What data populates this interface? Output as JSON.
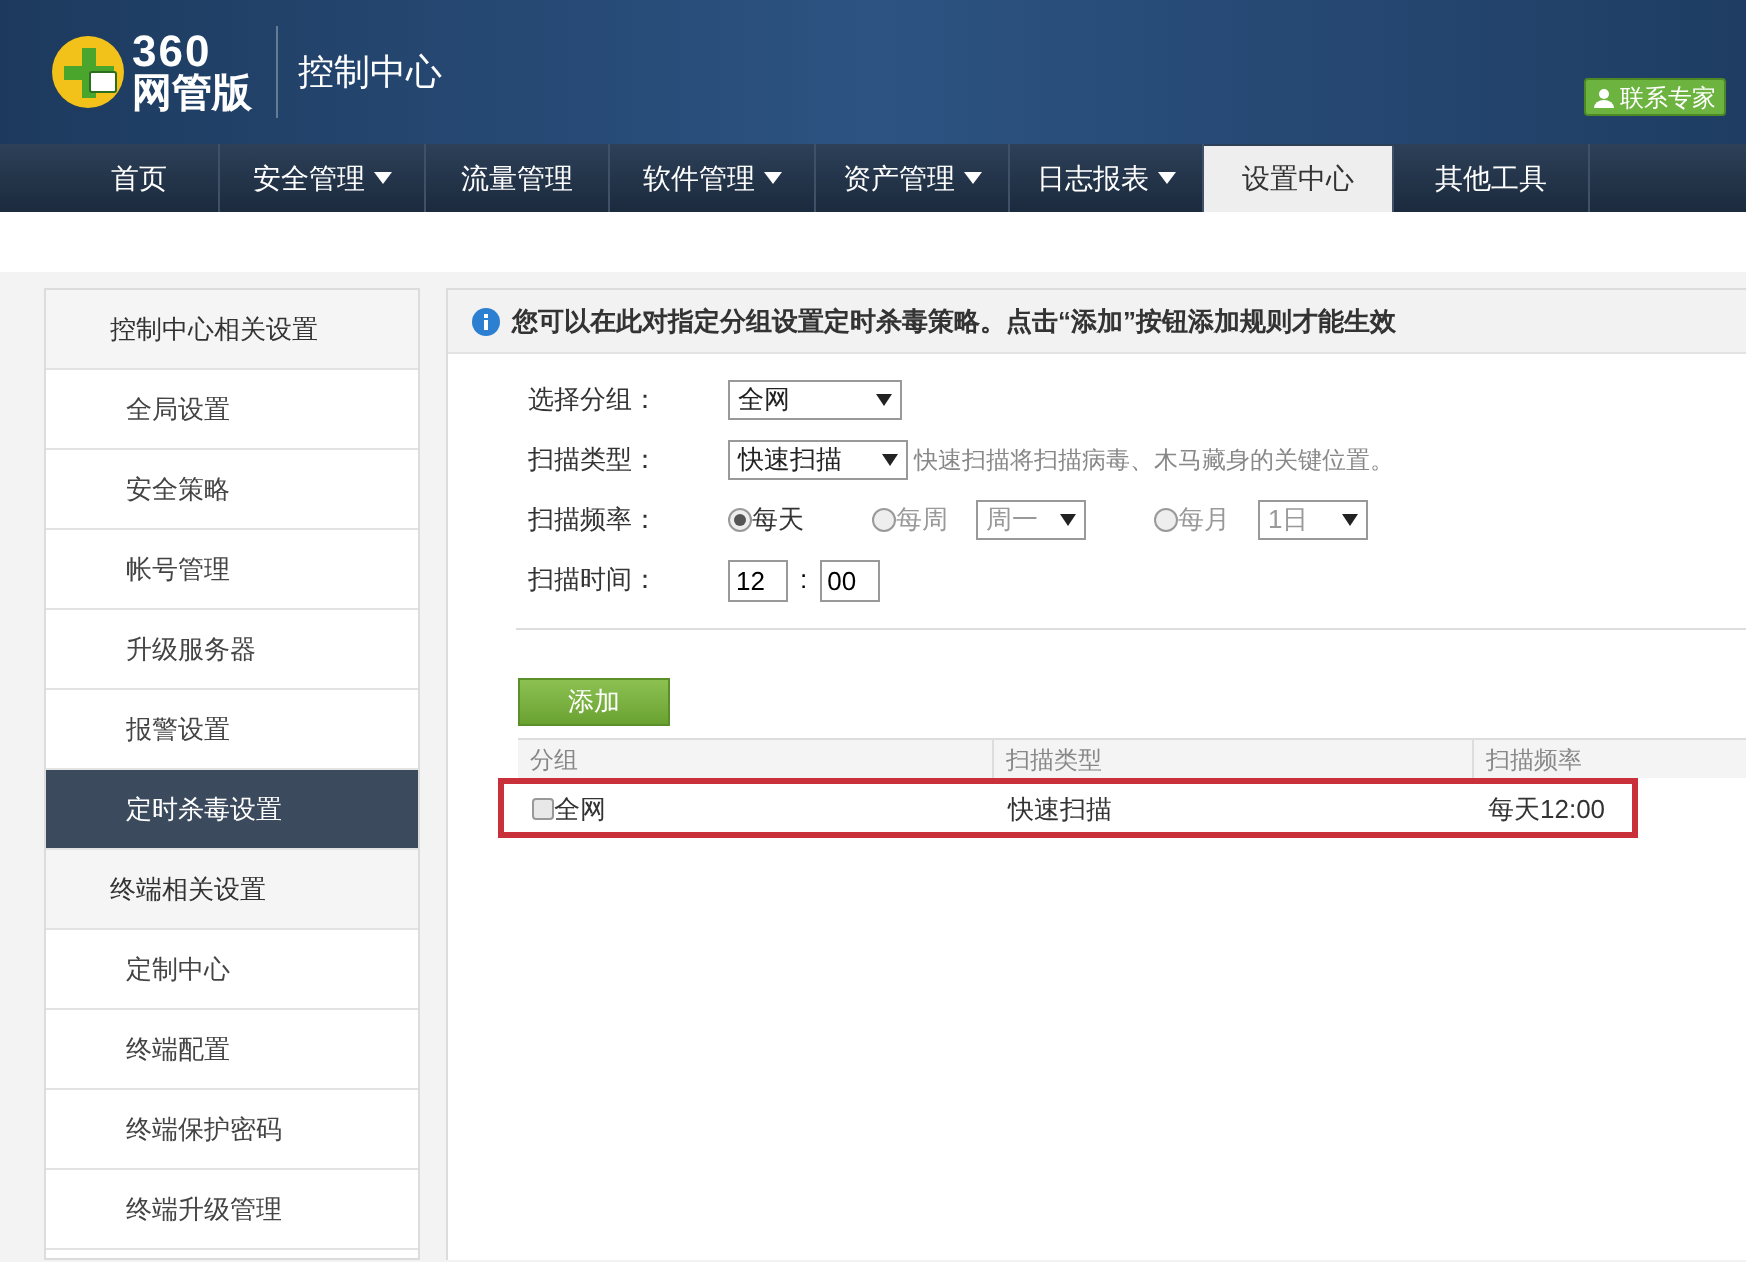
{
  "header": {
    "logo_number": "360",
    "logo_text": "网管版",
    "title": "控制中心",
    "contact_button": "联系专家"
  },
  "nav": [
    {
      "label": "首页",
      "dropdown": false,
      "selected": false
    },
    {
      "label": "安全管理",
      "dropdown": true,
      "selected": false
    },
    {
      "label": "流量管理",
      "dropdown": false,
      "selected": false
    },
    {
      "label": "软件管理",
      "dropdown": true,
      "selected": false
    },
    {
      "label": "资产管理",
      "dropdown": true,
      "selected": false
    },
    {
      "label": "日志报表",
      "dropdown": true,
      "selected": false
    },
    {
      "label": "设置中心",
      "dropdown": false,
      "selected": true
    },
    {
      "label": "其他工具",
      "dropdown": false,
      "selected": false
    }
  ],
  "sidebar": [
    {
      "kind": "section",
      "label": "控制中心相关设置"
    },
    {
      "kind": "item",
      "label": "全局设置",
      "selected": false
    },
    {
      "kind": "item",
      "label": "安全策略",
      "selected": false
    },
    {
      "kind": "item",
      "label": "帐号管理",
      "selected": false
    },
    {
      "kind": "item",
      "label": "升级服务器",
      "selected": false
    },
    {
      "kind": "item",
      "label": "报警设置",
      "selected": false
    },
    {
      "kind": "item",
      "label": "定时杀毒设置",
      "selected": true
    },
    {
      "kind": "section",
      "label": "终端相关设置"
    },
    {
      "kind": "item",
      "label": "定制中心",
      "selected": false
    },
    {
      "kind": "item",
      "label": "终端配置",
      "selected": false
    },
    {
      "kind": "item",
      "label": "终端保护密码",
      "selected": false
    },
    {
      "kind": "item",
      "label": "终端升级管理",
      "selected": false
    }
  ],
  "info": "您可以在此对指定分组设置定时杀毒策略。点击“添加”按钮添加规则才能生效",
  "form": {
    "group_label": "选择分组：",
    "group_value": "全网",
    "type_label": "扫描类型：",
    "type_value": "快速扫描",
    "type_hint": "快速扫描将扫描病毒、木马藏身的关键位置。",
    "freq_label": "扫描频率：",
    "freq_options": [
      {
        "label": "每天",
        "selected": true
      },
      {
        "label": "每周",
        "selected": false,
        "select_value": "周一"
      },
      {
        "label": "每月",
        "selected": false,
        "select_value": "1日"
      }
    ],
    "time_label": "扫描时间：",
    "hour": "12",
    "separator": ":",
    "minute": "00"
  },
  "add_button": "添加",
  "table": {
    "columns": [
      "分组",
      "扫描类型",
      "扫描频率"
    ],
    "rows": [
      {
        "checked": false,
        "highlighted": true,
        "cells": [
          "全网",
          "快速扫描",
          "每天12:00"
        ]
      }
    ]
  }
}
